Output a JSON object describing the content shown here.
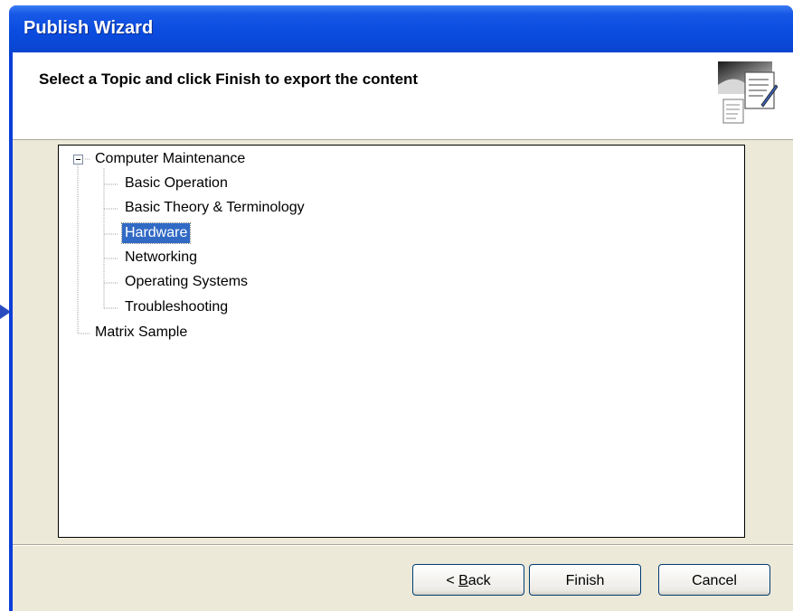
{
  "window": {
    "title": "Publish Wizard"
  },
  "header": {
    "heading": "Select a Topic and click Finish to export the content",
    "icon": "wizard-document-icon"
  },
  "tree": {
    "root": {
      "label": "Computer Maintenance",
      "expanded": true
    },
    "children": [
      {
        "label": "Basic Operation"
      },
      {
        "label": "Basic Theory & Terminology"
      },
      {
        "label": "Hardware",
        "selected": true
      },
      {
        "label": "Networking"
      },
      {
        "label": "Operating Systems"
      },
      {
        "label": "Troubleshooting"
      }
    ],
    "sibling": {
      "label": "Matrix Sample"
    }
  },
  "buttons": {
    "back": {
      "prefix": "< ",
      "mnemonic": "B",
      "rest": "ack"
    },
    "finish": "Finish",
    "cancel": "Cancel"
  },
  "colors": {
    "titlebar": "#0b4ce0",
    "selection": "#316ac5",
    "dialog_bg": "#ece9d8"
  }
}
